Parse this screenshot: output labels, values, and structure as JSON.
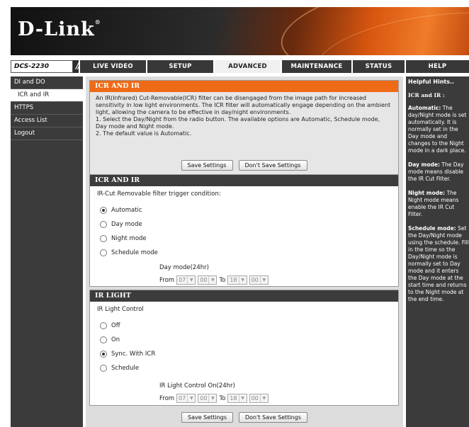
{
  "brand": {
    "logo": "D-Link",
    "reg": "®",
    "model": "DCS-2230",
    "slashes": "///"
  },
  "nav": {
    "tabs": [
      {
        "label": "LIVE VIDEO"
      },
      {
        "label": "SETUP"
      },
      {
        "label": "ADVANCED"
      },
      {
        "label": "MAINTENANCE"
      },
      {
        "label": "STATUS"
      },
      {
        "label": "HELP"
      }
    ],
    "active_tab": "ADVANCED"
  },
  "sidebar": {
    "items": [
      {
        "label": "DI and DO"
      },
      {
        "label": "ICR and IR"
      },
      {
        "label": "HTTPS"
      },
      {
        "label": "Access List"
      },
      {
        "label": "Logout"
      }
    ],
    "active_item": "ICR and IR"
  },
  "intro": {
    "title": "ICR AND IR",
    "lines": [
      "An IR(Infrared) Cut-Removable(ICR) filter can be disengaged from the image path for increased sensitivity in low light environments. The ICR filter will automatically engage depending on the ambient light, allowing the camera to be effective in day/night environments.",
      "1. Select the Day/Night from the radio button. The available options are Automatic, Schedule mode, Day mode and Night mode.",
      "2. The default value is Automatic."
    ],
    "save_label": "Save Settings",
    "dont_save_label": "Don't Save Settings"
  },
  "icr": {
    "title": "ICR AND IR",
    "condition_label": "IR-Cut Removable filter trigger condition:",
    "options": [
      {
        "label": "Automatic",
        "selected": true
      },
      {
        "label": "Day mode",
        "selected": false
      },
      {
        "label": "Night mode",
        "selected": false
      },
      {
        "label": "Schedule mode",
        "selected": false
      }
    ],
    "schedule_title": "Day mode(24hr)",
    "from_label": "From",
    "to_label": "To",
    "from_hour": "07",
    "from_min": "00",
    "to_hour": "18",
    "to_min": "00"
  },
  "irlight": {
    "title": "IR LIGHT",
    "control_label": "IR Light Control",
    "options": [
      {
        "label": "Off",
        "selected": false
      },
      {
        "label": "On",
        "selected": false
      },
      {
        "label": "Sync. With ICR",
        "selected": true
      },
      {
        "label": "Schedule",
        "selected": false
      }
    ],
    "schedule_title": "IR Light Control On(24hr)",
    "from_label": "From",
    "to_label": "To",
    "from_hour": "07",
    "from_min": "00",
    "to_hour": "18",
    "to_min": "00"
  },
  "footer": {
    "save_label": "Save Settings",
    "dont_save_label": "Don't Save Settings"
  },
  "hints": {
    "header": "Helpful Hints..",
    "subtitle": "ICR and IR :",
    "items": [
      {
        "term": "Automatic:",
        "text": " The day/Night mode is set automatically. It is normally set in the Day mode and changes to the Night mode in a dark place."
      },
      {
        "term": "Day mode:",
        "text": " The Day mode means disable the IR Cut Filter."
      },
      {
        "term": "Night mode:",
        "text": " The Night mode means enable the IR Cut Filter."
      },
      {
        "term": "Schedule mode:",
        "text": " Set the Day/Night mode using the schedule. Fill in the time so the Day/Night mode is normally set to Day mode and it enters the Day mode at the start time and returns to the Night mode at the end time."
      }
    ]
  },
  "colors": {
    "accent_orange": "#ef6a16",
    "dark_bar": "#3b3b3b",
    "panel_bg": "#dcdcdc"
  }
}
